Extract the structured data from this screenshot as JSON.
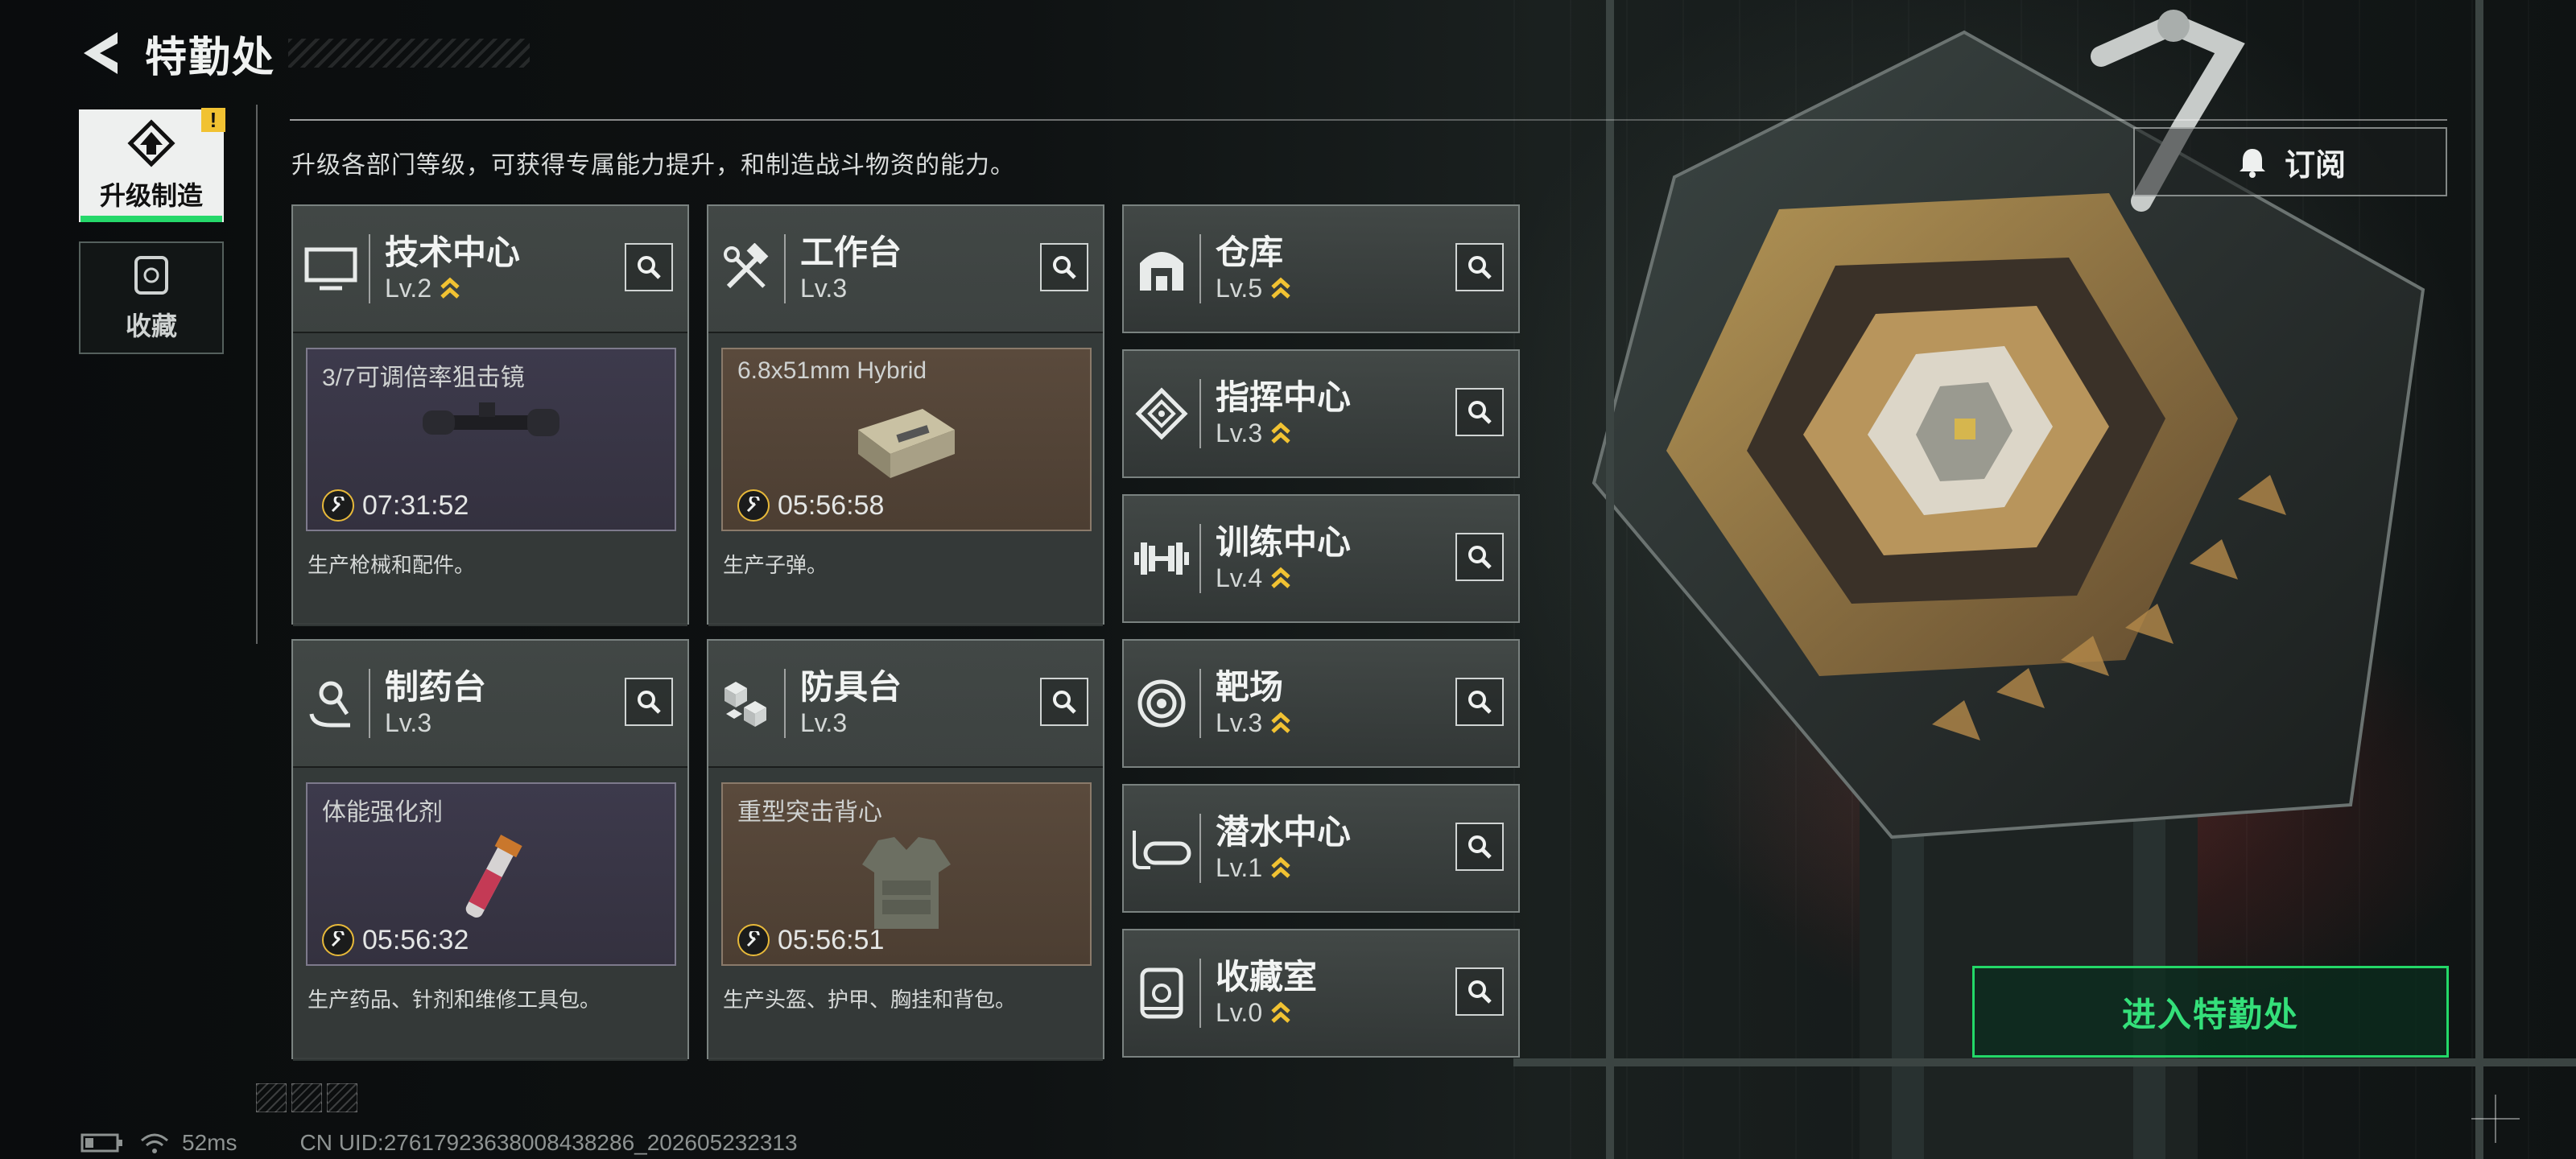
{
  "header": {
    "title": "特勤处"
  },
  "nav": {
    "tabs": [
      {
        "label": "升级制造",
        "active": true
      },
      {
        "label": "收藏",
        "active": false
      }
    ],
    "alert_badge": "!"
  },
  "description": "升级各部门等级，可获得专属能力提升，和制造战斗物资的能力。",
  "subscribe_label": "订阅",
  "enter_label": "进入特勤处",
  "colors": {
    "accent_green": "#23d868",
    "upgrade_chevron": "#f1c232",
    "alert_yellow": "#f1c232"
  },
  "facilities_main": [
    {
      "name": "技术中心",
      "level": "Lv.2",
      "upgradeable": true,
      "icon": "monitor-icon",
      "product": {
        "name": "3/7可调倍率狙击镜",
        "timer": "07:31:52",
        "color": "purple",
        "image": "scope-image"
      },
      "desc": "生产枪械和配件。"
    },
    {
      "name": "工作台",
      "level": "Lv.3",
      "upgradeable": false,
      "icon": "hammer-wrench-icon",
      "product": {
        "name": "6.8x51mm Hybrid",
        "timer": "05:56:58",
        "color": "brown",
        "image": "ammo-box-image"
      },
      "desc": "生产子弹。"
    },
    {
      "name": "制药台",
      "level": "Lv.3",
      "upgradeable": false,
      "icon": "microscope-icon",
      "product": {
        "name": "体能强化剂",
        "timer": "05:56:32",
        "color": "purple",
        "image": "syringe-image"
      },
      "desc": "生产药品、针剂和维修工具包。"
    },
    {
      "name": "防具台",
      "level": "Lv.3",
      "upgradeable": false,
      "icon": "blocks-icon",
      "product": {
        "name": "重型突击背心",
        "timer": "05:56:51",
        "color": "brown",
        "image": "vest-image"
      },
      "desc": "生产头盔、护甲、胸挂和背包。"
    }
  ],
  "facilities_side": [
    {
      "name": "仓库",
      "level": "Lv.5",
      "upgradeable": true,
      "icon": "warehouse-icon"
    },
    {
      "name": "指挥中心",
      "level": "Lv.3",
      "upgradeable": true,
      "icon": "command-diamond-icon"
    },
    {
      "name": "训练中心",
      "level": "Lv.4",
      "upgradeable": true,
      "icon": "dumbbell-icon"
    },
    {
      "name": "靶场",
      "level": "Lv.3",
      "upgradeable": true,
      "icon": "target-icon"
    },
    {
      "name": "潜水中心",
      "level": "Lv.1",
      "upgradeable": true,
      "icon": "diving-mask-icon"
    },
    {
      "name": "收藏室",
      "level": "Lv.0",
      "upgradeable": true,
      "icon": "collection-room-icon"
    }
  ],
  "status": {
    "ping": "52ms",
    "uid": "CN UID:276179236380084382​86_202605232313"
  }
}
